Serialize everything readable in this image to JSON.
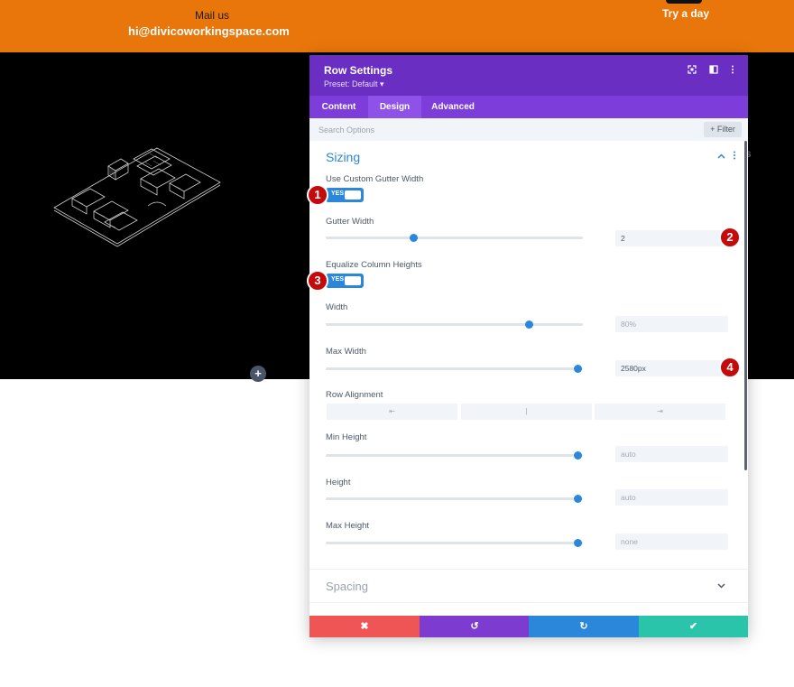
{
  "header": {
    "mail_label": "Mail us",
    "mail_address": "hi@divicoworkingspace.com",
    "try_label": "Try a day"
  },
  "hero": {
    "ghost_text": "s",
    "add_button_glyph": "+"
  },
  "modal": {
    "title": "Row Settings",
    "preset": "Preset: Default ▾",
    "icons": [
      "fullscreen-icon",
      "split-view-icon",
      "more-options-icon"
    ],
    "tabs": [
      {
        "label": "Content",
        "active": false
      },
      {
        "label": "Design",
        "active": true
      },
      {
        "label": "Advanced",
        "active": false
      }
    ],
    "search": {
      "placeholder": "Search Options",
      "filter_label": "+ Filter"
    },
    "sizing": {
      "title": "Sizing",
      "use_custom_gutter": {
        "label": "Use Custom Gutter Width",
        "toggle_text": "YES",
        "value": true
      },
      "gutter_width": {
        "label": "Gutter Width",
        "value": "2",
        "slider_fraction": 0.34
      },
      "equalize_heights": {
        "label": "Equalize Column Heights",
        "toggle_text": "YES",
        "value": true
      },
      "width": {
        "label": "Width",
        "value": "80%",
        "slider_fraction": 0.79
      },
      "max_width": {
        "label": "Max Width",
        "value": "2580px",
        "slider_fraction": 0.98
      },
      "row_alignment": {
        "label": "Row Alignment",
        "options": [
          "⇤",
          "|",
          "⇥"
        ]
      },
      "min_height": {
        "label": "Min Height",
        "value": "auto",
        "slider_fraction": 0.98
      },
      "height": {
        "label": "Height",
        "value": "auto",
        "slider_fraction": 0.98
      },
      "max_height": {
        "label": "Max Height",
        "value": "none",
        "slider_fraction": 0.98
      }
    },
    "spacing": {
      "title": "Spacing"
    },
    "footer": {
      "cancel_glyph": "✖",
      "undo_glyph": "↺",
      "redo_glyph": "↻",
      "save_glyph": "✔"
    }
  },
  "markers": [
    "1",
    "2",
    "3",
    "4"
  ],
  "colors": {
    "topbar": "#e9760a",
    "modal_header": "#6b2ec2",
    "tabs": "#7d3ddb",
    "accent": "#2b87da",
    "cancel": "#ef5555",
    "undo": "#7e3bd0",
    "redo": "#2b87da",
    "save": "#29c4a9",
    "marker": "#c40a0a"
  }
}
